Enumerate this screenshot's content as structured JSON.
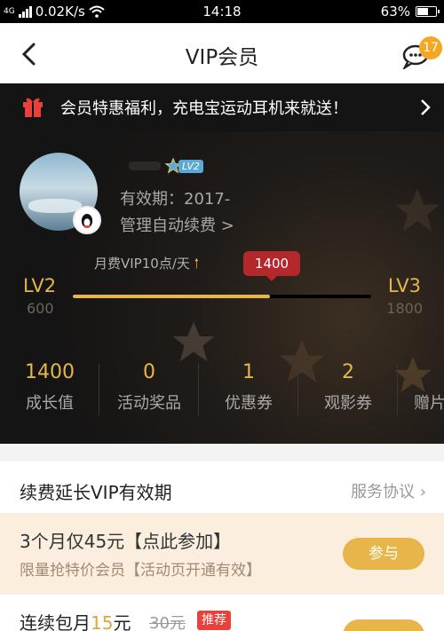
{
  "status_bar": {
    "network": "4G",
    "speed": "0.02K/s",
    "time": "14:18",
    "battery": "63%",
    "battery_level": 0.63
  },
  "nav": {
    "title": "VIP会员",
    "message_count": "17"
  },
  "promo": {
    "text": "会员特惠福利，充电宝运动耳机来就送！"
  },
  "profile": {
    "level_badge": "LV2",
    "validity": "有效期：2017-",
    "auto_renew": "管理自动续费 >"
  },
  "level": {
    "monthly_rate": "月费VIP10点/天",
    "current_points": "1400",
    "current_level": "LV2",
    "current_level_points": "600",
    "next_level": "LV3",
    "next_level_points": "1800",
    "progress": 0.66
  },
  "stats": [
    {
      "value": "1400",
      "label": "成长值"
    },
    {
      "value": "0",
      "label": "活动奖品"
    },
    {
      "value": "1",
      "label": "优惠券"
    },
    {
      "value": "2",
      "label": "观影券"
    },
    {
      "value": "",
      "label": "赠片"
    }
  ],
  "renew": {
    "title": "续费延长VIP有效期",
    "agreement": "服务协议",
    "offer_title": "3个月仅45元【点此参加】",
    "offer_sub": "限量抢特价会员【活动页开通有效】",
    "join_label": "参与",
    "monthly_prefix": "连续包月",
    "monthly_price": "15",
    "monthly_unit": "元",
    "monthly_old": "30元",
    "recommend": "推荐"
  },
  "colors": {
    "gold": "#e5b64a",
    "banner_bg": "#141414",
    "offer_bg": "#fbeedf",
    "badge": "#f5a623",
    "red": "#b4272b"
  }
}
